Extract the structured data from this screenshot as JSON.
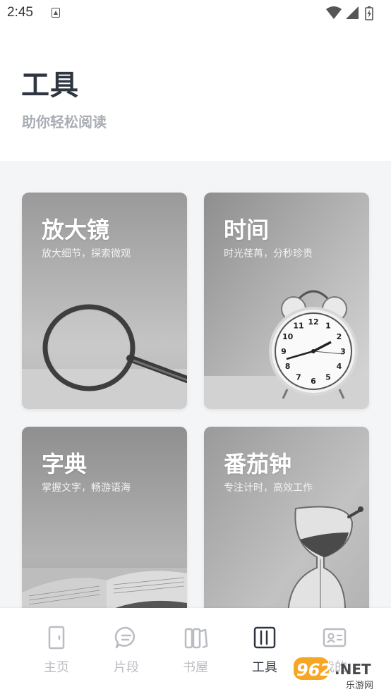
{
  "status_bar": {
    "time": "2:45",
    "icons": [
      "notification-icon",
      "wifi-icon",
      "signal-icon",
      "battery-icon"
    ]
  },
  "header": {
    "title": "工具",
    "subtitle": "助你轻松阅读"
  },
  "cards": [
    {
      "title": "放大镜",
      "desc": "放大细节，探索微观",
      "icon": "magnifying-glass"
    },
    {
      "title": "时间",
      "desc": "时光荏苒，分秒珍贵",
      "icon": "alarm-clock"
    },
    {
      "title": "字典",
      "desc": "掌握文字，畅游语海",
      "icon": "open-book"
    },
    {
      "title": "番茄钟",
      "desc": "专注计时，高效工作",
      "icon": "hourglass"
    }
  ],
  "clock_numbers": [
    "12",
    "1",
    "2",
    "3",
    "4",
    "5",
    "6",
    "7",
    "8",
    "9",
    "10",
    "11"
  ],
  "nav": {
    "items": [
      {
        "label": "主页",
        "icon": "door-icon",
        "active": false
      },
      {
        "label": "片段",
        "icon": "chat-bubble-icon",
        "active": false
      },
      {
        "label": "书屋",
        "icon": "books-icon",
        "active": false
      },
      {
        "label": "工具",
        "icon": "tools-icon",
        "active": true
      },
      {
        "label": "我的",
        "icon": "profile-card-icon",
        "active": false
      }
    ]
  },
  "watermark": {
    "brand": "962",
    "suffix": ".NET",
    "site": "乐游网"
  },
  "colors": {
    "title": "#2f3640",
    "subtitle": "#a9adb4",
    "nav_inactive": "#b9bcc2",
    "nav_active": "#2f3640",
    "page_bg": "#f4f5f7"
  }
}
